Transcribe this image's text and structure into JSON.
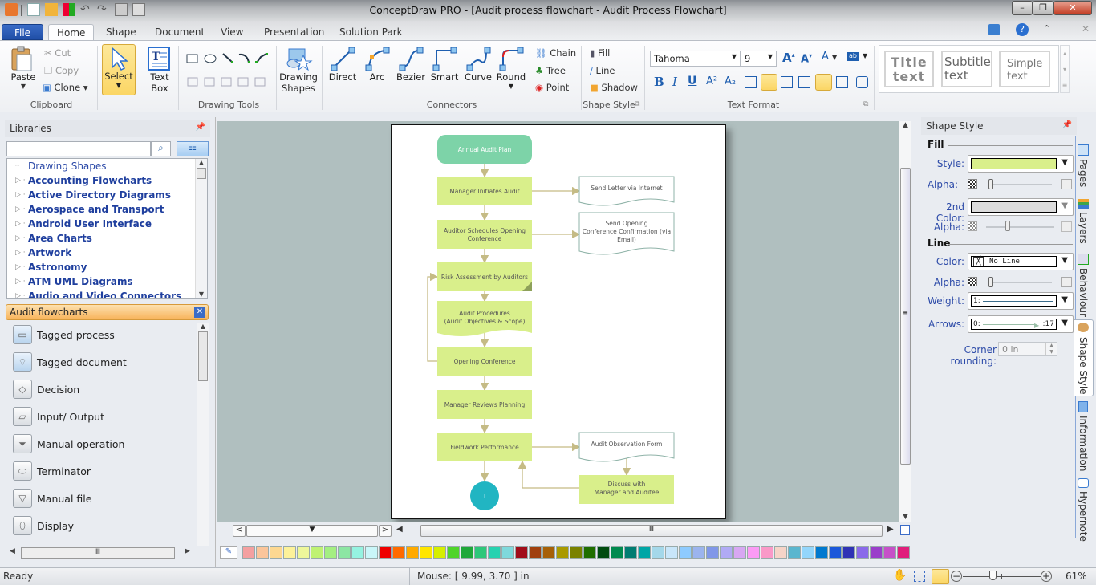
{
  "window": {
    "title": "ConceptDraw PRO - [Audit process flowchart - Audit Process Flowchart]",
    "minimize": "–",
    "restore": "❐",
    "close": "✕"
  },
  "ribbon_tabs": [
    "File",
    "Home",
    "Shape",
    "Document",
    "View",
    "Presentation",
    "Solution Park"
  ],
  "active_tab": "Home",
  "clipboard": {
    "paste": "Paste",
    "cut": "Cut",
    "copy": "Copy",
    "clone": "Clone",
    "label": "Clipboard"
  },
  "select": {
    "label": "Select"
  },
  "textbox": {
    "line1": "Text",
    "line2": "Box"
  },
  "drawing_tools": {
    "label": "Drawing Tools"
  },
  "drawing_shapes": {
    "line1": "Drawing",
    "line2": "Shapes"
  },
  "connectors": {
    "label": "Connectors",
    "items": [
      "Direct",
      "Arc",
      "Bezier",
      "Smart",
      "Curve",
      "Round"
    ],
    "chain": "Chain",
    "tree": "Tree",
    "point": "Point"
  },
  "shape_style_group": {
    "fill": "Fill",
    "line": "Line",
    "shadow": "Shadow",
    "label": "Shape Style"
  },
  "text_format": {
    "font": "Tahoma",
    "size": "9",
    "label": "Text Format",
    "bold": "B",
    "italic": "I",
    "underline": "U"
  },
  "text_styles": [
    {
      "line1": "Title",
      "line2": "text"
    },
    {
      "line1": "Subtitle",
      "line2": "text"
    },
    {
      "line1": "Simple",
      "line2": "text"
    }
  ],
  "libraries": {
    "title": "Libraries",
    "search_placeholder": "",
    "items": [
      {
        "label": "Drawing Shapes",
        "plain": true
      },
      {
        "label": "Accounting Flowcharts"
      },
      {
        "label": "Active Directory Diagrams"
      },
      {
        "label": "Aerospace and Transport"
      },
      {
        "label": "Android User Interface"
      },
      {
        "label": "Area Charts"
      },
      {
        "label": "Artwork"
      },
      {
        "label": "Astronomy"
      },
      {
        "label": "ATM UML Diagrams"
      },
      {
        "label": "Audio and Video Connectors"
      }
    ]
  },
  "open_library": {
    "title": "Audit flowcharts",
    "shapes": [
      "Tagged process",
      "Tagged document",
      "Decision",
      "Input/ Output",
      "Manual operation",
      "Terminator",
      "Manual file",
      "Display"
    ]
  },
  "diagram": {
    "start": "Annual Audit Plan",
    "steps": [
      "Manager Initiates Audit",
      "Auditor Schedules Opening Conference",
      "Risk Assessment by Auditors",
      "Audit Procedures (Audit Objectives & Scope)",
      "Opening Conference",
      "Manager Reviews Planning",
      "Fieldwork Performance"
    ],
    "documents": [
      "Send Letter via Internet",
      "Send Opening Conference Confirmation (via Email)",
      "Audit Observation Form"
    ],
    "discuss": "Discuss with Manager and Auditee",
    "connector_label": "1",
    "colors": {
      "process": "#d9ef8b",
      "terminator": "#7dd3a8",
      "connector": "#c5bb85",
      "circle": "#21b5c2",
      "doc_border": "#8fb3a8"
    }
  },
  "shape_style_panel": {
    "title": "Shape Style",
    "fill_section": "Fill",
    "style_label": "Style:",
    "style_color": "#d9ef8b",
    "alpha_label": "Alpha:",
    "second_color_label": "2nd Color:",
    "second_color": "#dcdcdc",
    "line_section": "Line",
    "color_label": "Color:",
    "color_value": "No Line",
    "weight_label": "Weight:",
    "weight_value": "1:",
    "arrows_label": "Arrows:",
    "arrows_start": "0:",
    "arrows_end": ":17",
    "corner_label": "Corner rounding:",
    "corner_value": "0 in"
  },
  "side_tabs": [
    "Pages",
    "Layers",
    "Behaviour",
    "Shape Style",
    "Information",
    "Hypernote"
  ],
  "palette": [
    "#f4a0a0",
    "#fbc59a",
    "#fdd891",
    "#fdf29a",
    "#eef79a",
    "#bff273",
    "#a4ef82",
    "#8ce6a3",
    "#95f3e1",
    "#c9f6f9",
    "#ee0000",
    "#ff6a00",
    "#ffaa00",
    "#ffe600",
    "#d6ef00",
    "#4fd42a",
    "#1fa83a",
    "#2dc77a",
    "#26d2b0",
    "#7ed9dc",
    "#a00d1a",
    "#a0400e",
    "#a66008",
    "#a99a00",
    "#7a8200",
    "#1f6e00",
    "#004c10",
    "#008a4f",
    "#007d72",
    "#00a6a6",
    "#a4d8ea",
    "#c8e6fa",
    "#8ecbff",
    "#9bb4ee",
    "#8097e8",
    "#b0aaf5",
    "#d7a7f2",
    "#fb9bf5",
    "#fa99c8",
    "#f6d4c8",
    "#5ab6cf",
    "#93d6fb",
    "#0079cf",
    "#1b58da",
    "#2f33b5",
    "#8a6aea",
    "#9a3fca",
    "#c651c8",
    "#e01e7c"
  ],
  "status": {
    "ready": "Ready",
    "mouse": "Mouse: [ 9.99, 3.70 ] in",
    "zoom": "61%",
    "zoom_fraction": 0.61
  }
}
